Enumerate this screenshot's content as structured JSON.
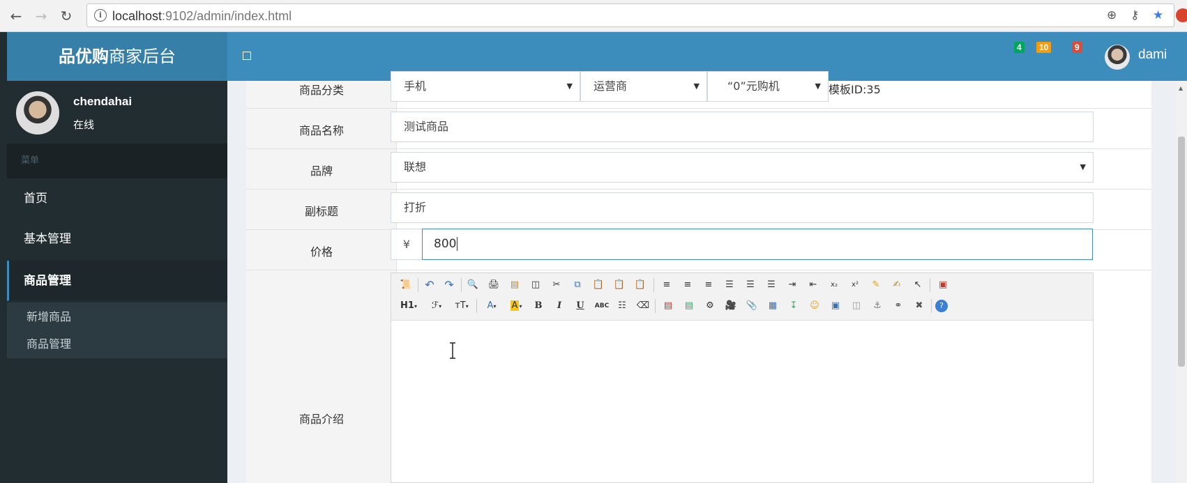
{
  "browser": {
    "url_host": "localhost",
    "url_rest": ":9102/admin/index.html"
  },
  "header": {
    "brand_bold": "品优购",
    "brand_rest": "商家后台",
    "badges": [
      {
        "value": "4",
        "color": "#00a65a"
      },
      {
        "value": "10",
        "color": "#f39c12"
      },
      {
        "value": "9",
        "color": "#dd4b39"
      }
    ],
    "user": "dami"
  },
  "sidebar": {
    "user_name": "chendahai",
    "user_status": "在线",
    "menu_header": "菜单",
    "items": [
      {
        "label": "首页"
      },
      {
        "label": "基本管理"
      },
      {
        "label": "商品管理"
      }
    ],
    "sub_items": [
      {
        "label": "新增商品"
      },
      {
        "label": "商品管理"
      }
    ]
  },
  "form": {
    "category_label": "商品分类",
    "category_1": "手机",
    "category_2": "运营商",
    "category_3": "“0”元购机",
    "template_id": "模板ID:35",
    "name_label": "商品名称",
    "name_value": "测试商品",
    "brand_label": "品牌",
    "brand_value": "联想",
    "subtitle_label": "副标题",
    "subtitle_value": "打折",
    "price_label": "价格",
    "price_currency": "¥",
    "price_value": "800",
    "intro_label": "商品介绍"
  },
  "editor": {
    "heading_btn": "H1",
    "font_btn": "ℱ",
    "size_btn": "тT",
    "color_btn": "A",
    "bg_btn": "A",
    "bold": "B",
    "italic": "I",
    "underline": "U",
    "strike": "ABC"
  }
}
